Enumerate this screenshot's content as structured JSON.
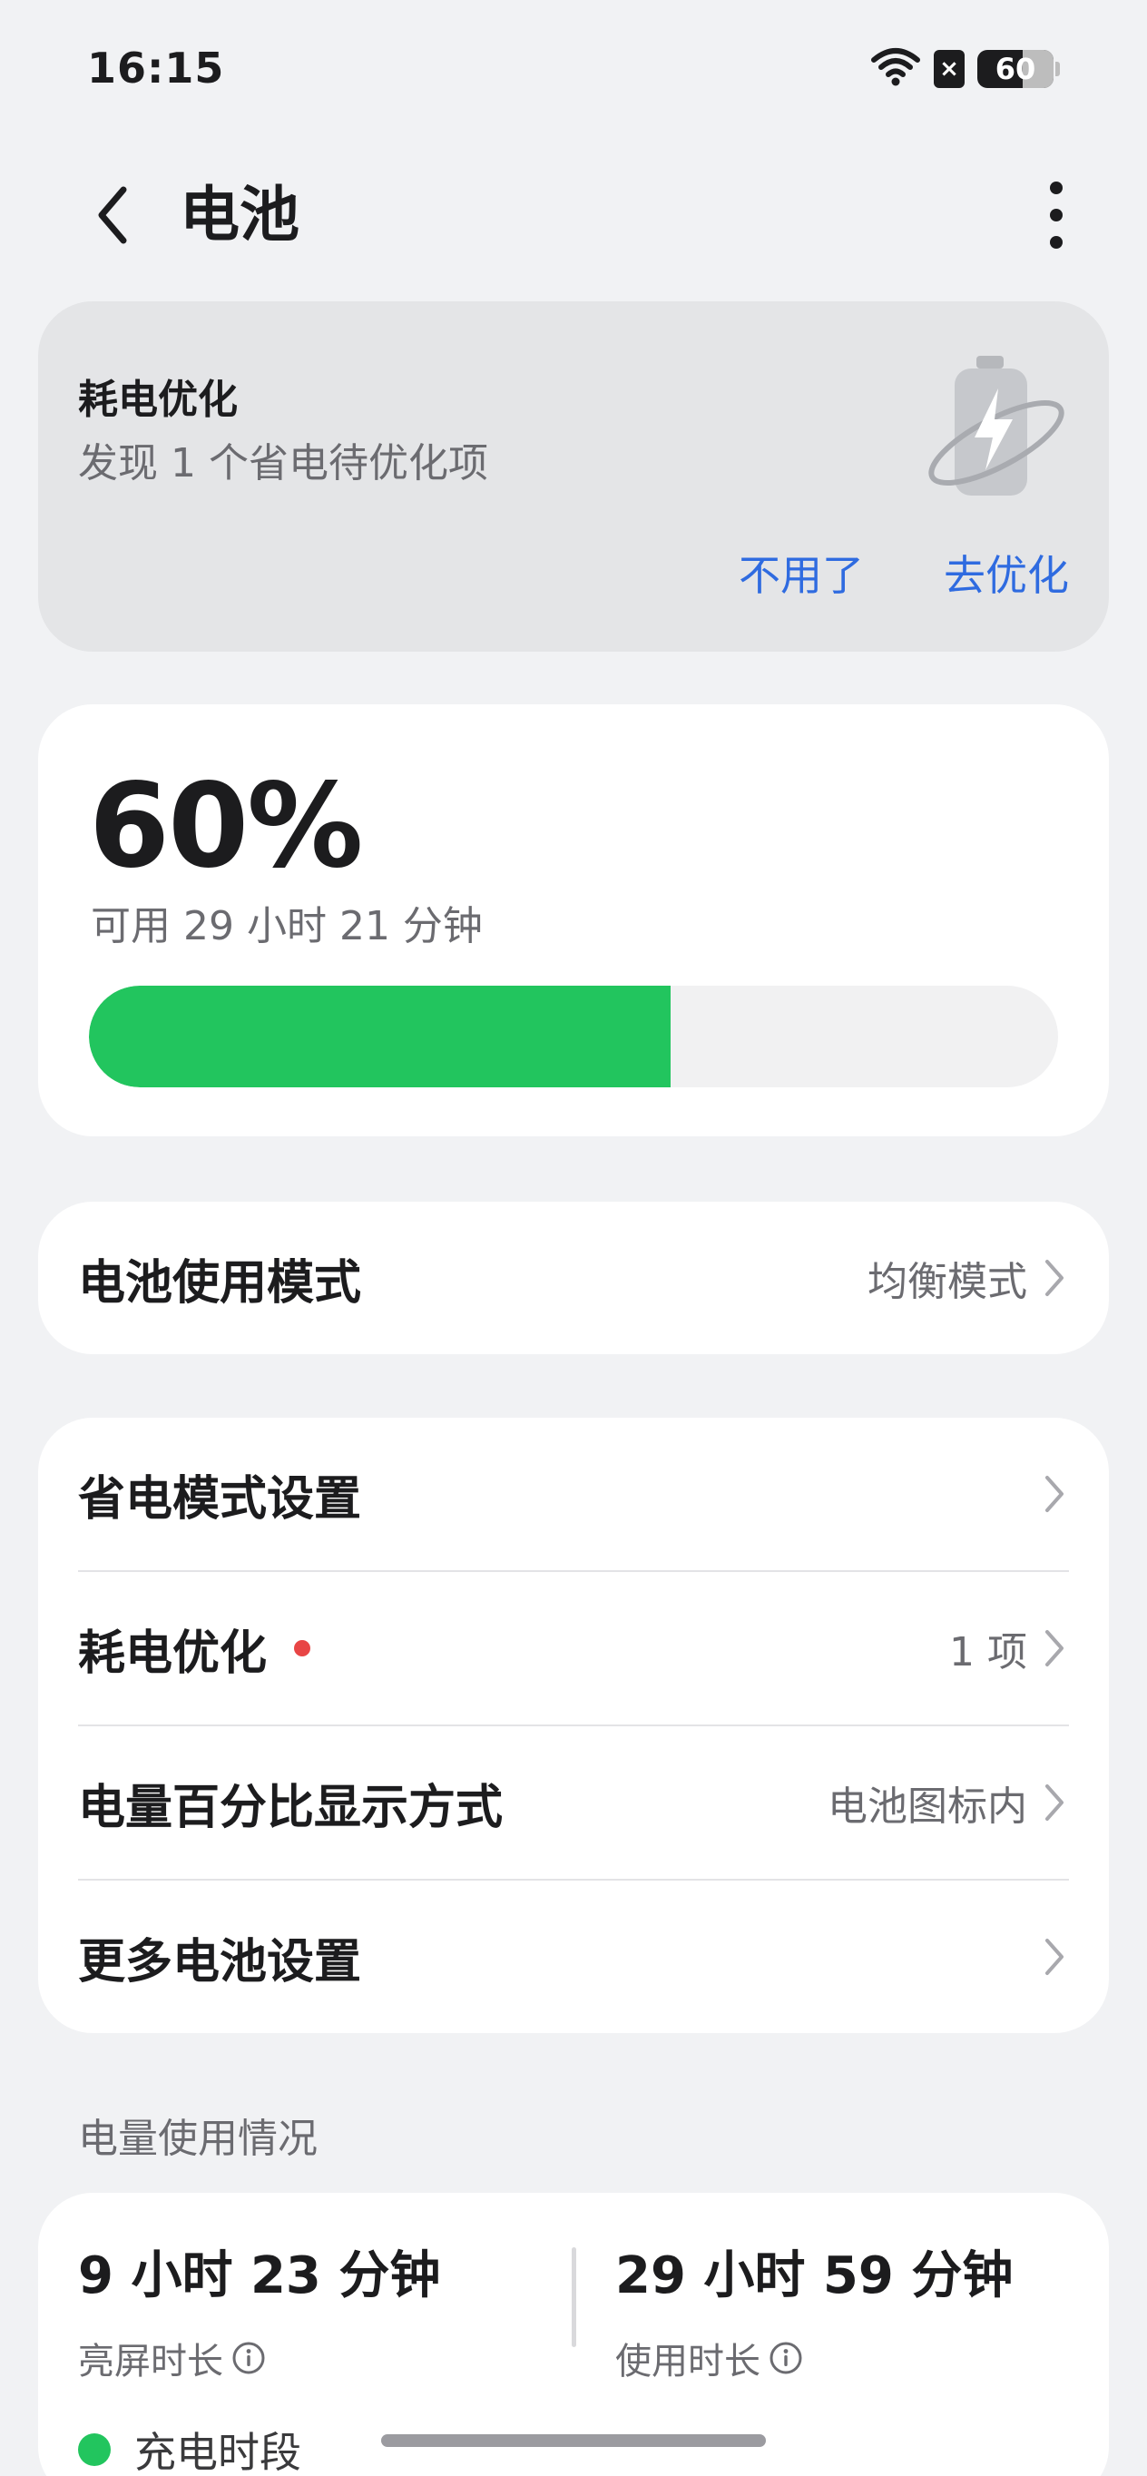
{
  "status_bar": {
    "time": "16:15",
    "battery_text": "60",
    "sim_mark": "×",
    "icons": [
      "wifi-icon",
      "sim-icon",
      "battery-icon"
    ]
  },
  "header": {
    "title": "电池",
    "back_icon": "chevron-left-icon",
    "more_icon": "more-vertical-icon"
  },
  "optimize_card": {
    "title": "耗电优化",
    "description": "发现 1 个省电待优化项",
    "dismiss_label": "不用了",
    "optimize_label": "去优化",
    "illustration": "battery-charging-illustration"
  },
  "battery_level": {
    "percent_text": "60%",
    "remaining": "可用 29 小时 21 分钟",
    "level_fraction": 0.6
  },
  "mode_card": {
    "label": "电池使用模式",
    "value": "均衡模式"
  },
  "settings": {
    "items": [
      {
        "label": "省电模式设置",
        "value": ""
      },
      {
        "label": "耗电优化",
        "value": "1 项",
        "badge": "red-dot"
      },
      {
        "label": "电量百分比显示方式",
        "value": "电池图标内"
      },
      {
        "label": "更多电池设置",
        "value": ""
      }
    ]
  },
  "usage": {
    "section_title": "电量使用情况",
    "screen_on_value": "9 小时 23 分钟",
    "screen_on_label": "亮屏时长",
    "usage_value": "29 小时 59 分钟",
    "usage_label": "使用时长",
    "legend_label": "充电时段"
  },
  "colors": {
    "accent": "#2f6be0",
    "battery_green": "#22c55e",
    "badge_red": "#e84545",
    "background": "#f1f2f4"
  }
}
